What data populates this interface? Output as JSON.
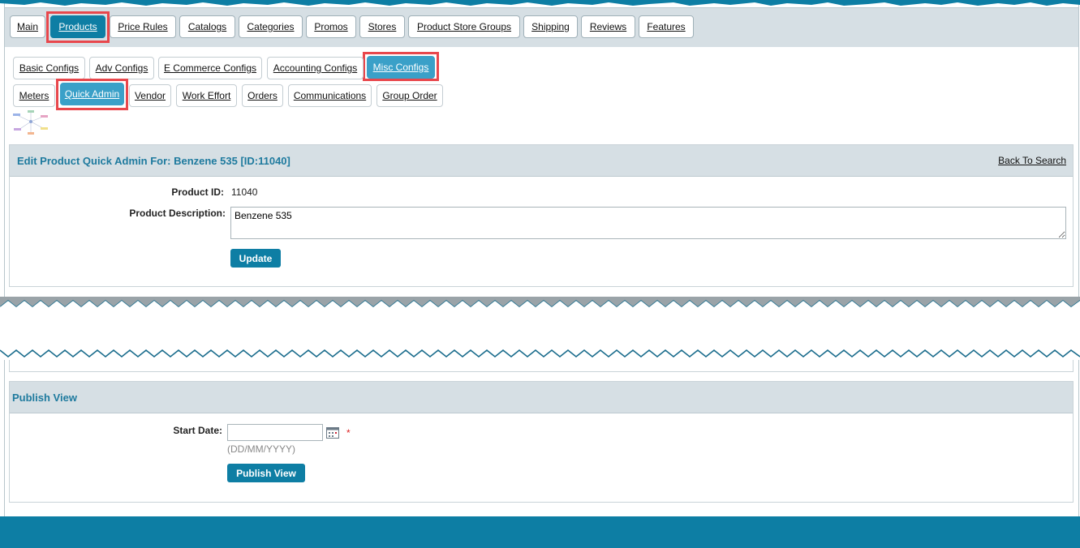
{
  "main_tabs": [
    {
      "label": "Main"
    },
    {
      "label": "Products"
    },
    {
      "label": "Price Rules"
    },
    {
      "label": "Catalogs"
    },
    {
      "label": "Categories"
    },
    {
      "label": "Promos"
    },
    {
      "label": "Stores"
    },
    {
      "label": "Product Store Groups"
    },
    {
      "label": "Shipping"
    },
    {
      "label": "Reviews"
    },
    {
      "label": "Features"
    }
  ],
  "sub_tabs_row1": [
    {
      "label": "Basic Configs"
    },
    {
      "label": "Adv Configs"
    },
    {
      "label": "E Commerce Configs"
    },
    {
      "label": "Accounting Configs"
    },
    {
      "label": "Misc Configs"
    }
  ],
  "sub_tabs_row2": [
    {
      "label": "Meters"
    },
    {
      "label": "Quick Admin"
    },
    {
      "label": "Vendor"
    },
    {
      "label": "Work Effort"
    },
    {
      "label": "Orders"
    },
    {
      "label": "Communications"
    },
    {
      "label": "Group Order"
    }
  ],
  "edit_panel": {
    "title": "Edit Product Quick Admin For: Benzene 535 [ID:11040]",
    "back_link": "Back To Search",
    "product_id_label": "Product ID:",
    "product_id_value": "11040",
    "description_label": "Product Description:",
    "description_value": "Benzene 535",
    "update_button": "Update"
  },
  "publish_panel": {
    "title": "Publish View",
    "start_date_label": "Start Date:",
    "start_date_value": "",
    "required_marker": "*",
    "date_format_hint": "(DD/MM/YYYY)",
    "publish_button": "Publish View"
  },
  "colors": {
    "accent": "#0e7ea4",
    "active_subtab": "#3aa0c8",
    "highlight": "#e8474c",
    "header_bg": "#d6dfe4",
    "title_text": "#1e7a9e"
  }
}
